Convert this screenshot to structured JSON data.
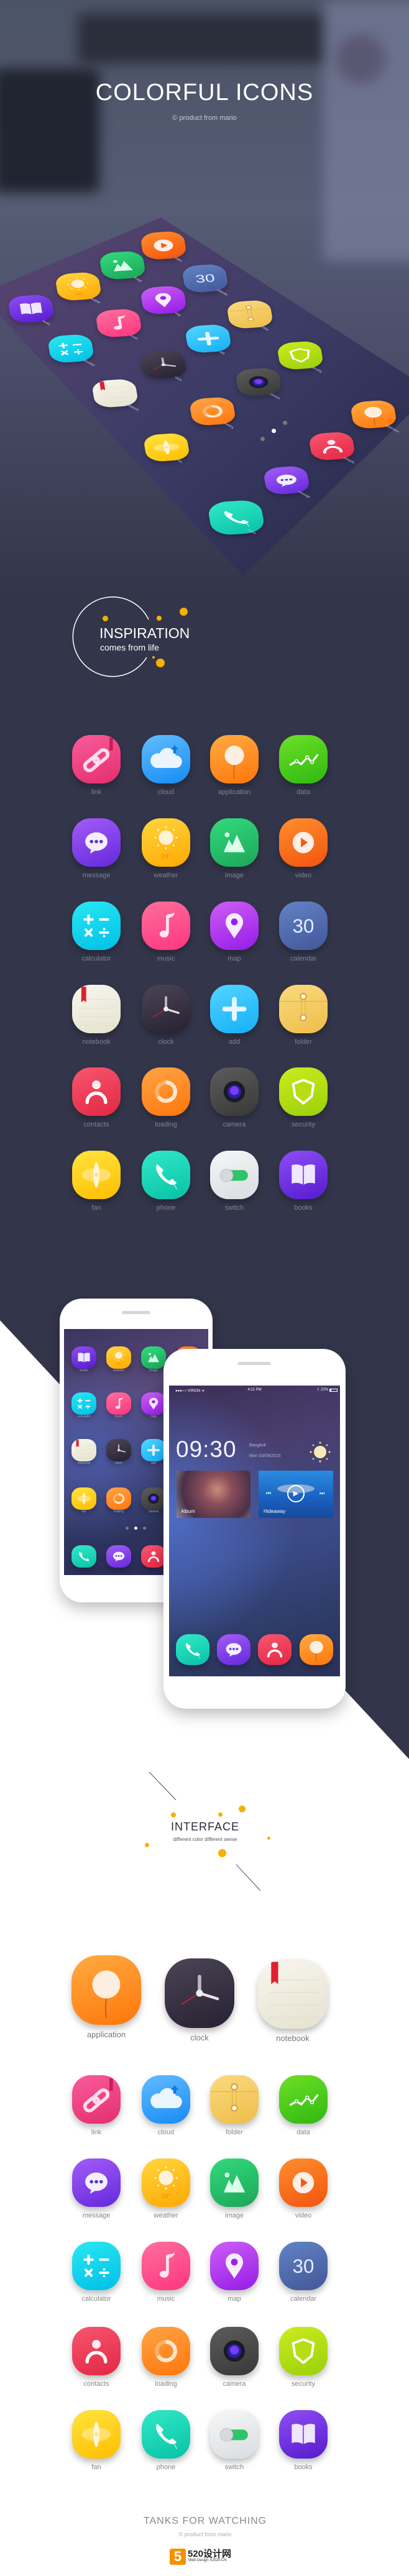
{
  "hero": {
    "title": "COLORFUL ICONS",
    "subtitle": "product from mario",
    "copyright_icon": "copyright-icon"
  },
  "hero_screen": {
    "labels": [
      "books",
      "weather",
      "image",
      "video",
      "calendar",
      "map",
      "music",
      "calculator",
      "folder",
      "add",
      "clock",
      "notebook",
      "security",
      "camera",
      "loading",
      "fan",
      "application",
      "contacts",
      "message",
      "phone"
    ]
  },
  "inspiration": {
    "title": "INSPIRATION",
    "subtitle": "comes from life"
  },
  "icon_styles": {
    "link": [
      "#f95c9c",
      "#e42d6c"
    ],
    "cloud": [
      "#62bcff",
      "#168cf3"
    ],
    "application": [
      "#ffab42",
      "#ff760a"
    ],
    "data": [
      "#6ee026",
      "#2fb812"
    ],
    "message": [
      "#a35cf7",
      "#6429dd"
    ],
    "weather": [
      "#ffd640",
      "#ffa800"
    ],
    "image": [
      "#33da7e",
      "#1ba657"
    ],
    "video": [
      "#ff8e2e",
      "#f2540e"
    ],
    "calculator": [
      "#2ae8f2",
      "#00bfe6"
    ],
    "music": [
      "#ff6f9c",
      "#fd357f"
    ],
    "map": [
      "#cc5ff6",
      "#961be6"
    ],
    "calendar": [
      "#6283c4",
      "#42579a"
    ],
    "notebook": [
      "#f8f6ee",
      "#e6e2cf"
    ],
    "clock": [
      "#4b4557",
      "#262130"
    ],
    "add": [
      "#52d6ff",
      "#16aef8"
    ],
    "folder": [
      "#f9da7e",
      "#efbd4a"
    ],
    "contacts": [
      "#f7566f",
      "#e32744"
    ],
    "loading": [
      "#ffa446",
      "#ff760c"
    ],
    "camera": [
      "#5c5c5c",
      "#383838"
    ],
    "security": [
      "#cbec1e",
      "#9ad00a"
    ],
    "fan": [
      "#ffe43e",
      "#ffbe00"
    ],
    "phone": [
      "#32e8c8",
      "#08c2a6"
    ],
    "switch": [
      "#f6f7f8",
      "#d9dce0"
    ],
    "books": [
      "#8e4ef6",
      "#561bcd"
    ]
  },
  "weather_temp": "24°",
  "calendar_day": "30",
  "dark_grid": [
    {
      "icon": "link",
      "label": "link"
    },
    {
      "icon": "cloud",
      "label": "cloud"
    },
    {
      "icon": "application",
      "label": "application"
    },
    {
      "icon": "data",
      "label": "data"
    },
    {
      "icon": "message",
      "label": "message"
    },
    {
      "icon": "weather",
      "label": "weather"
    },
    {
      "icon": "image",
      "label": "image"
    },
    {
      "icon": "video",
      "label": "video"
    },
    {
      "icon": "calculator",
      "label": "calculator"
    },
    {
      "icon": "music",
      "label": "music"
    },
    {
      "icon": "map",
      "label": "map"
    },
    {
      "icon": "calendar",
      "label": "calendar"
    },
    {
      "icon": "notebook",
      "label": "notebook"
    },
    {
      "icon": "clock",
      "label": "clock"
    },
    {
      "icon": "add",
      "label": "add"
    },
    {
      "icon": "folder",
      "label": "folder"
    },
    {
      "icon": "contacts",
      "label": "contacts"
    },
    {
      "icon": "loading",
      "label": "loading"
    },
    {
      "icon": "camera",
      "label": "camera"
    },
    {
      "icon": "security",
      "label": "security"
    },
    {
      "icon": "fan",
      "label": "fan"
    },
    {
      "icon": "phone",
      "label": "phone"
    },
    {
      "icon": "switch",
      "label": "switch"
    },
    {
      "icon": "books",
      "label": "books"
    }
  ],
  "phones": {
    "back": {
      "icons": [
        {
          "icon": "books",
          "label": "books"
        },
        {
          "icon": "weather",
          "label": "weather"
        },
        {
          "icon": "image",
          "label": "image"
        },
        {
          "icon": "video",
          "label": ""
        },
        {
          "icon": "calculator",
          "label": "calculator"
        },
        {
          "icon": "music",
          "label": "music"
        },
        {
          "icon": "map",
          "label": "map"
        },
        {
          "icon": "notebook",
          "label": "notebook"
        },
        {
          "icon": "clock",
          "label": "clock"
        },
        {
          "icon": "add",
          "label": "add"
        },
        {
          "icon": "fan",
          "label": "fan"
        },
        {
          "icon": "loading",
          "label": "loading"
        },
        {
          "icon": "camera",
          "label": "camera"
        }
      ],
      "dock": [
        "phone",
        "message",
        "contacts"
      ],
      "page_indicator": {
        "pages": 3,
        "active": 2
      }
    },
    "front": {
      "carrier": "VIRGIN",
      "time": "4:21 PM",
      "battery": "22%",
      "battery_level": 0.22,
      "clock": "09:30",
      "city": "Bangkok",
      "date": "Mon 03/09/2015",
      "cards": [
        "Album",
        "Hideaway"
      ],
      "dock": [
        "phone",
        "message",
        "contacts",
        "application"
      ]
    }
  },
  "interface": {
    "title": "INTERFACE",
    "subtitle": "different color different sense"
  },
  "featured": [
    {
      "icon": "application",
      "label": "application"
    },
    {
      "icon": "clock",
      "label": "clock"
    },
    {
      "icon": "notebook",
      "label": "notebook"
    }
  ],
  "light_grid": [
    {
      "icon": "link",
      "label": "link"
    },
    {
      "icon": "cloud",
      "label": "cloud"
    },
    {
      "icon": "folder",
      "label": "folder"
    },
    {
      "icon": "data",
      "label": "data"
    },
    {
      "icon": "message",
      "label": "message"
    },
    {
      "icon": "weather",
      "label": "weather"
    },
    {
      "icon": "image",
      "label": "image"
    },
    {
      "icon": "video",
      "label": "video"
    },
    {
      "icon": "calculator",
      "label": "calculator"
    },
    {
      "icon": "music",
      "label": "music"
    },
    {
      "icon": "map",
      "label": "map"
    },
    {
      "icon": "calendar",
      "label": "calendar"
    },
    {
      "icon": "contacts",
      "label": "contacts"
    },
    {
      "icon": "loading",
      "label": "loading"
    },
    {
      "icon": "camera",
      "label": "camera"
    },
    {
      "icon": "security",
      "label": "security"
    },
    {
      "icon": "fan",
      "label": "fan"
    },
    {
      "icon": "phone",
      "label": "phone"
    },
    {
      "icon": "switch",
      "label": "switch"
    },
    {
      "icon": "books",
      "label": "books"
    }
  ],
  "footer": {
    "title": "TANKS FOR WATCHING",
    "subtitle": "product from mario",
    "logo_mark": "5",
    "logo_text": "520设计网",
    "logo_sub": "Web Design  SJ520.CN",
    "logo_color": "#f39200"
  }
}
